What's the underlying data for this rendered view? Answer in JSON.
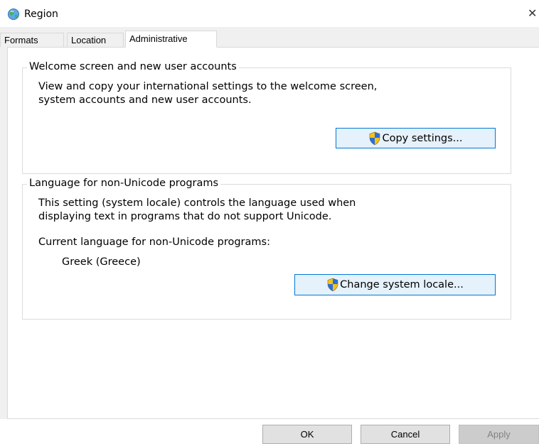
{
  "window": {
    "title": "Region",
    "close_glyph": "✕",
    "icon": "region-globe-icon"
  },
  "tabs": [
    {
      "label": "Formats",
      "active": false
    },
    {
      "label": "Location",
      "active": false
    },
    {
      "label": "Administrative",
      "active": true
    }
  ],
  "welcome_group": {
    "legend": "Welcome screen and new user accounts",
    "description_line1": "View and copy your international settings to the welcome screen,",
    "description_line2": "system accounts and new user accounts.",
    "button_label": "Copy settings..."
  },
  "unicode_group": {
    "legend": "Language for non-Unicode programs",
    "description_line1": "This setting (system locale) controls the language used when",
    "description_line2": "displaying text in programs that do not support Unicode.",
    "current_label": "Current language for non-Unicode programs:",
    "current_value": "Greek (Greece)",
    "button_label": "Change system locale..."
  },
  "footer": {
    "ok_label": "OK",
    "cancel_label": "Cancel",
    "apply_label": "Apply"
  },
  "colors": {
    "accent": "#0078d7",
    "shield_yellow": "#f7c21b",
    "shield_blue": "#2a6fd6"
  }
}
